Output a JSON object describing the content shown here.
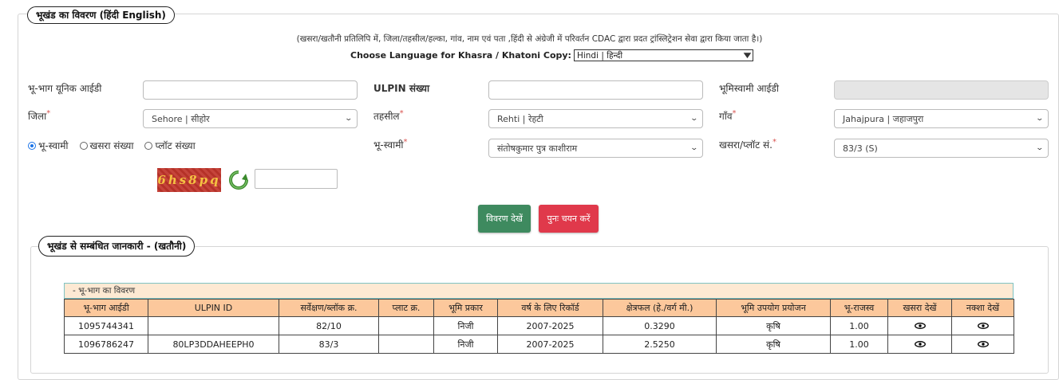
{
  "section_title": "भूखंड का विवरण  (हिंदी  English)",
  "info_text": "(खसरा/खतौनी प्रतिलिपि में, जिला/तहसील/हल्का, गांव, नाम एवं पता ,हिंदी से अंग्रेजी में परिवर्तन CDAC द्वारा प्रदत ट्रांस्लिट्रेशन सेवा द्वारा किया जाता है।)",
  "language": {
    "label": "Choose Language for Khasra / Khatoni Copy:",
    "selected": "Hindi | हिन्दी"
  },
  "form": {
    "unique_id_label": "भू-भाग यूनिक आईडी",
    "ulpin_label": "ULPIN संख्या",
    "bhumiswami_id_label": "भूमिस्वामी आईडी",
    "district_label": "जिला",
    "district_value": "Sehore | सीहोर",
    "tehsil_label": "तहसील",
    "tehsil_value": "Rehti | रेहटी",
    "village_label": "गाँव",
    "village_value": "Jahajpura | जहाजपुरा",
    "radio_owner": "भू-स्वामी",
    "radio_khasra": "खसरा संख्या",
    "radio_plot": "प्लॉट संख्या",
    "owner_label": "भू-स्वामी",
    "owner_value": "संतोषकुमार पुत्र काशीराम",
    "khasra_label": "खसरा/प्लॉट सं.",
    "khasra_value": "83/3 (S)",
    "required_mark": "*"
  },
  "captcha": {
    "text": "6hs8pq"
  },
  "buttons": {
    "view": "विवरण देखें",
    "reset": "पुनः चयन करें"
  },
  "khatoni": {
    "title": "भूखंड से सम्बंधित जानकारी -  (खतौनी)",
    "table_caption": "- भू-भाग का विवरण",
    "headers": [
      "भू-भाग आईडी",
      "ULPIN ID",
      "सर्वेक्षण/ब्लॉक क्र.",
      "प्लाट क्र.",
      "भूमि प्रकार",
      "वर्ष के लिए रिकॉर्ड",
      "क्षेत्रफल (हे./वर्ग मी.)",
      "भूमि उपयोग प्रयोजन",
      "भू-राजस्व",
      "खसरा देखें",
      "नक्शा देखें"
    ],
    "rows": [
      [
        "1095744341",
        "",
        "82/10",
        "",
        "निजी",
        "2007-2025",
        "0.3290",
        "कृषि",
        "1.00"
      ],
      [
        "1096786247",
        "80LP3DDAHEEPH0",
        "83/3",
        "",
        "निजी",
        "2007-2025",
        "2.5250",
        "कृषि",
        "1.00"
      ]
    ]
  },
  "colors": {
    "header_bg": "#fcc89c",
    "caption_bg": "#fde9d3",
    "button_green": "#3e8a5f",
    "button_red": "#e0394b"
  }
}
